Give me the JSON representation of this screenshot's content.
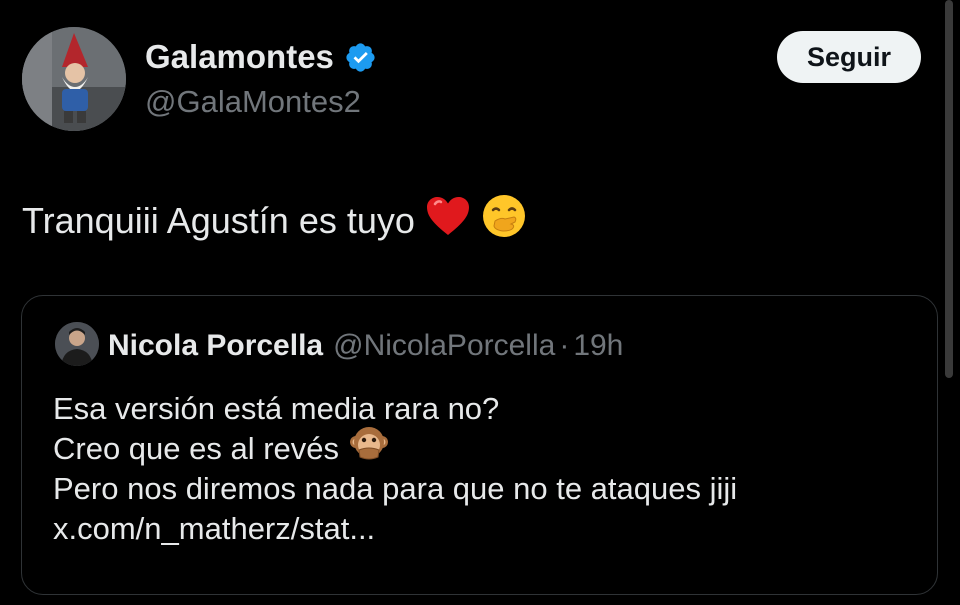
{
  "author": {
    "display_name": "Galamontes",
    "handle": "@GalaMontes2",
    "verified_icon": "verified-badge-icon",
    "avatar_icon": "gnome-avatar-icon"
  },
  "follow_button": {
    "label": "Seguir"
  },
  "tweet": {
    "text": "Tranquiii Agustín es tuyo",
    "emojis": [
      "red-heart-icon",
      "face-with-hand-over-mouth-icon"
    ]
  },
  "quoted_tweet": {
    "author_name": "Nicola Porcella",
    "handle": "@NicolaPorcella",
    "separator": "·",
    "time": "19h",
    "lines": [
      "Esa versión está media rara no?",
      "Creo que es al revés",
      "Pero nos diremos nada para que no te ataques jiji",
      "x.com/n_matherz/stat..."
    ],
    "line2_emoji": "speak-no-evil-monkey-icon"
  },
  "colors": {
    "background": "#000000",
    "text_primary": "#e7e9ea",
    "text_secondary": "#71767b",
    "verified_blue": "#1d9bf0",
    "border": "#2f3336",
    "button_bg": "#eff3f4"
  }
}
